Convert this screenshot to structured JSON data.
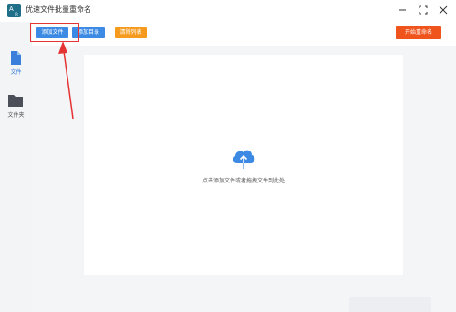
{
  "window": {
    "title": "优速文件批量重命名",
    "icon": "app-logo-icon",
    "controls": [
      "minimize-icon",
      "maximize-icon",
      "close-icon"
    ]
  },
  "sidebar": {
    "items": [
      {
        "label": "文件",
        "icon": "file-icon",
        "active": true
      },
      {
        "label": "文件夹",
        "icon": "folder-icon",
        "active": false
      }
    ]
  },
  "toolbar": {
    "add_file_label": "添加文件",
    "add_dir_label": "添加目录",
    "clear_list_label": "清除列表",
    "start_rename_label": "开始重命名"
  },
  "drop_area": {
    "icon": "cloud-upload-icon",
    "hint": "点击添加文件或者拖拽文件到此处"
  },
  "colors": {
    "primary": "#3c8ae3",
    "warning": "#f59a1d",
    "danger": "#f0541d",
    "annotation": "#e43434"
  }
}
